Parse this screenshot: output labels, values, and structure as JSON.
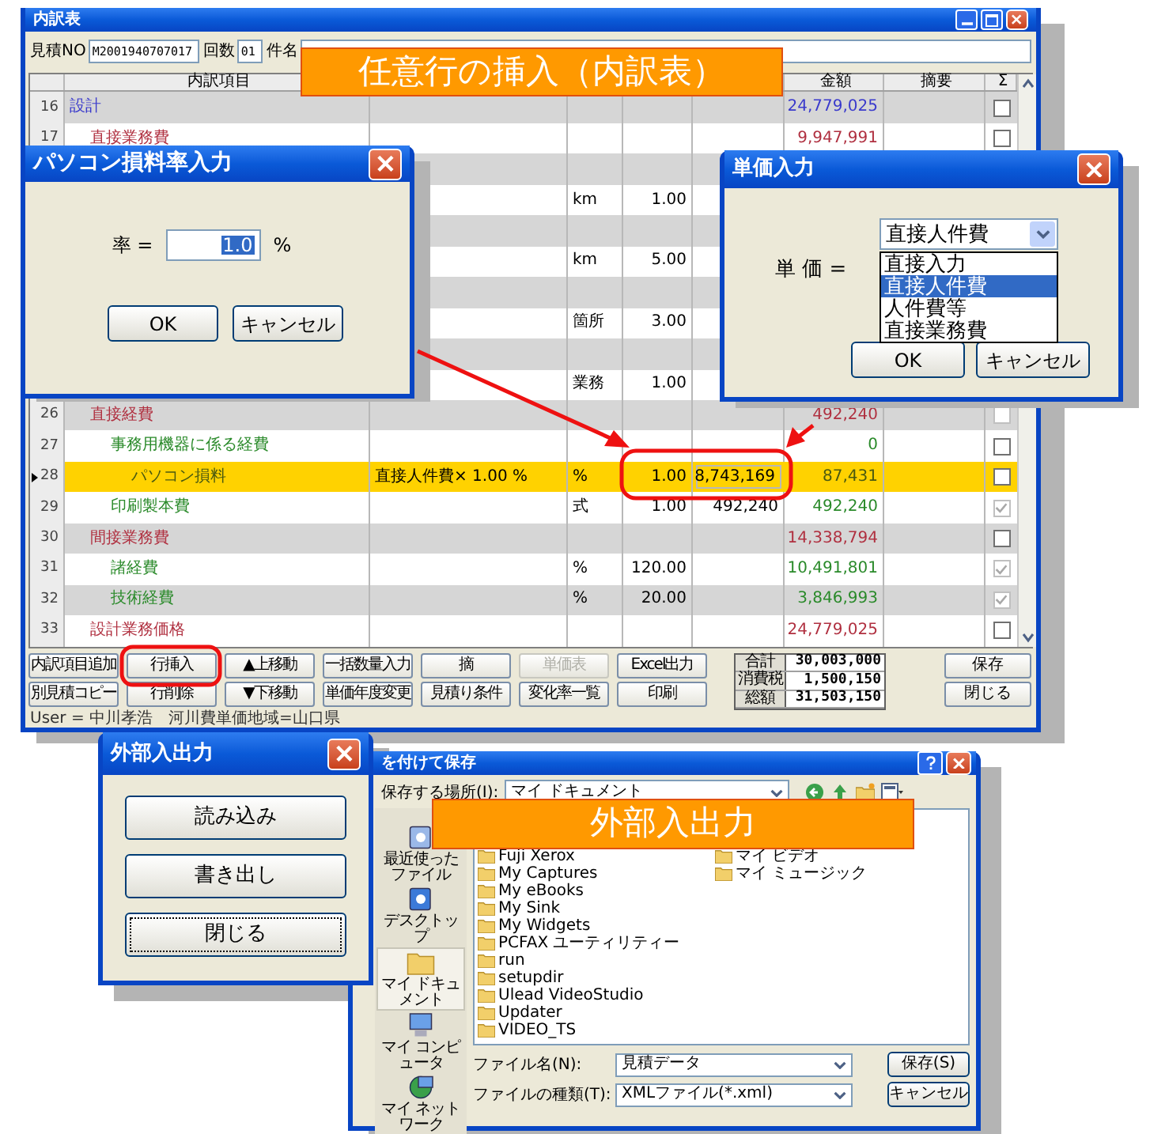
{
  "main_window": {
    "title": "内訳表",
    "fields": [
      {
        "label": "見積NO",
        "value": "M2001940707017"
      },
      {
        "label": "回数",
        "value": "01"
      },
      {
        "label": "件名"
      }
    ],
    "table": {
      "headers": {
        "item": "内訳項目",
        "amount": "金額",
        "memo": "摘要",
        "check": "Σ"
      },
      "rows": [
        {
          "no": "16",
          "name": "設計",
          "color": "#3a3acc",
          "amount": "24,779,025",
          "checked": false,
          "disabled": false,
          "selected": false,
          "children": [
            {
              "no": "17",
              "name": "直接業務費",
              "color": "#b03040",
              "amount": "9,947,991",
              "checked": false,
              "disabled": false,
              "selected": false,
              "children": [
                {
                  "selected": false
                },
                {
                  "unit": "km",
                  "qty": "1.00",
                  "selected": false
                },
                {
                  "selected": false
                },
                {
                  "unit": "km",
                  "qty": "5.00",
                  "selected": false
                },
                {
                  "selected": false
                },
                {
                  "unit": "箇所",
                  "qty": "3.00",
                  "selected": false
                },
                {
                  "selected": false
                },
                {
                  "unit": "業務",
                  "qty": "1.00",
                  "selected": false
                }
              ]
            },
            {
              "no": "26",
              "name": "直接経費",
              "color": "#b03040",
              "amount": "492,240",
              "checked": false,
              "disabled": true,
              "selected": false,
              "children": [
                {
                  "no": "27",
                  "name": "事務用機器に係る経費",
                  "color": "#2a8a2a",
                  "amount": "0",
                  "checked": false,
                  "disabled": false,
                  "selected": false,
                  "children": [
                    {
                      "no": "28",
                      "name": "パソコン損料",
                      "color": "#4a5a10",
                      "spec": "直接人件費× 1.00 %",
                      "unit": "%",
                      "qty": "1.00",
                      "price": "8,743,169",
                      "amount": "87,431",
                      "checked": false,
                      "disabled": false,
                      "selected": true
                    }
                  ]
                },
                {
                  "no": "29",
                  "name": "印刷製本費",
                  "color": "#2a8a2a",
                  "unit": "式",
                  "qty": "1.00",
                  "price": "492,240",
                  "amount": "492,240",
                  "checked": true,
                  "disabled": true,
                  "selected": false
                }
              ]
            },
            {
              "no": "30",
              "name": "間接業務費",
              "color": "#b03040",
              "amount": "14,338,794",
              "checked": false,
              "disabled": false,
              "selected": false,
              "children": [
                {
                  "no": "31",
                  "name": "諸経費",
                  "color": "#2a8a2a",
                  "unit": "%",
                  "qty": "120.00",
                  "amount": "10,491,801",
                  "checked": true,
                  "disabled": true,
                  "selected": false
                },
                {
                  "no": "32",
                  "name": "技術経費",
                  "color": "#2a8a2a",
                  "unit": "%",
                  "qty": "20.00",
                  "amount": "3,846,993",
                  "checked": true,
                  "disabled": true,
                  "selected": false
                }
              ]
            },
            {
              "no": "33",
              "name": "設計業務価格",
              "color": "#b03040",
              "amount": "24,779,025",
              "checked": false,
              "disabled": false,
              "selected": false
            }
          ]
        }
      ]
    },
    "buttons_top": [
      {
        "label": "内訳項目追加",
        "disabled": false
      },
      {
        "label": "行挿入",
        "disabled": false
      },
      {
        "label": "▲上移動",
        "disabled": false
      },
      {
        "label": "一括数量入力",
        "disabled": false
      },
      {
        "label": "摘",
        "disabled": false
      },
      {
        "label": "単価表",
        "disabled": true
      },
      {
        "label": "Excel出力",
        "disabled": false
      }
    ],
    "buttons_bottom": [
      {
        "label": "別見積コピー",
        "disabled": false
      },
      {
        "label": "行削除",
        "disabled": false
      },
      {
        "label": "▼下移動",
        "disabled": false
      },
      {
        "label": "単価年度変更",
        "disabled": false
      },
      {
        "label": "見積り条件",
        "disabled": false
      },
      {
        "label": "変化率一覧",
        "disabled": false
      },
      {
        "label": "印刷",
        "disabled": false
      }
    ],
    "totals": [
      {
        "label": "合計",
        "value": "30,003,000"
      },
      {
        "label": "消費税",
        "value": "1,500,150"
      },
      {
        "label": "総額",
        "value": "31,503,150"
      }
    ],
    "side_buttons": [
      "保存",
      "閉じる"
    ],
    "status_bar": "User = 中川孝浩　河川費単価地域=山口県"
  },
  "rate_dialog": {
    "title": "パソコン損料率入力",
    "label": "率 =",
    "value": "1.0",
    "unit": "%",
    "buttons": [
      "OK",
      "キャンセル"
    ]
  },
  "price_dialog": {
    "title": "単価入力",
    "label": "単 価 =",
    "value": "直接人件費",
    "options": [
      {
        "label": "直接入力",
        "selected": false
      },
      {
        "label": "直接人件費",
        "selected": true
      },
      {
        "label": "人件費等",
        "selected": false
      },
      {
        "label": "直接業務費",
        "selected": false
      }
    ],
    "buttons": [
      "OK",
      "キャンセル"
    ]
  },
  "io_dialog": {
    "title": "外部入出力",
    "buttons": [
      {
        "label": "読み込み",
        "focused": false
      },
      {
        "label": "書き出し",
        "focused": false
      },
      {
        "label": "閉じる",
        "focused": true
      }
    ]
  },
  "save_dialog": {
    "title": "を付けて保存",
    "location_label": "保存する場所(I):",
    "location": "マイ ドキュメント",
    "places": [
      {
        "label": "最近使ったファイル",
        "selected": false
      },
      {
        "label": "デスクトップ",
        "selected": false
      },
      {
        "label": "マイ ドキュメント",
        "selected": true
      },
      {
        "label": "マイ コンピュータ",
        "selected": false
      },
      {
        "label": "マイ ネットワーク",
        "selected": false
      }
    ],
    "files": [
      "Fuji Xerox",
      "My Captures",
      "My eBooks",
      "My Sink",
      "My Widgets",
      "PCFAX ユーティリティー",
      "run",
      "setupdir",
      "Ulead VideoStudio",
      "Updater",
      "VIDEO_TS",
      "マイ ビデオ",
      "マイ ミュージック"
    ],
    "filename_label": "ファイル名(N):",
    "filename": "見積データ",
    "type_label": "ファイルの種類(T):",
    "type": "XMLファイル(*.xml)",
    "buttons": [
      "保存(S)",
      "キャンセル"
    ]
  },
  "banners": [
    "任意行の挿入（内訳表）",
    "外部入出力"
  ]
}
